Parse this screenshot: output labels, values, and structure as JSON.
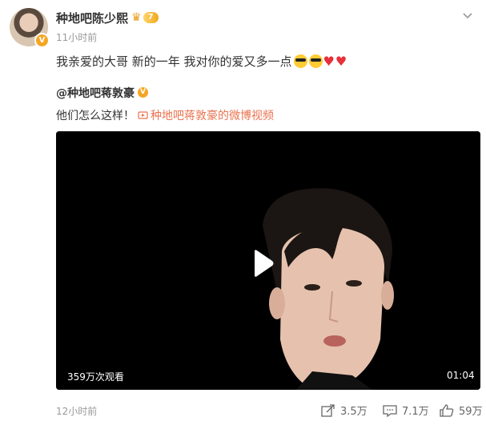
{
  "header": {
    "username": "种地吧陈少熙",
    "vip_level": "7",
    "timestamp": "11小时前",
    "more_icon": "chevron-down-icon"
  },
  "post": {
    "text": "我亲爱的大哥 新的一年  我对你的爱又多一点"
  },
  "repost": {
    "mention": "@种地吧蒋敦豪",
    "text": "他们怎么这样！",
    "video_link": "种地吧蒋敦豪的微博视频"
  },
  "video": {
    "views": "359万次观看",
    "duration": "01:04"
  },
  "footer": {
    "timestamp": "12小时前",
    "share_count": "3.5万",
    "comment_count": "7.1万",
    "like_count": "59万"
  },
  "colors": {
    "accent": "#eb7350",
    "badge": "#f5a623",
    "heart": "#e8303a"
  }
}
